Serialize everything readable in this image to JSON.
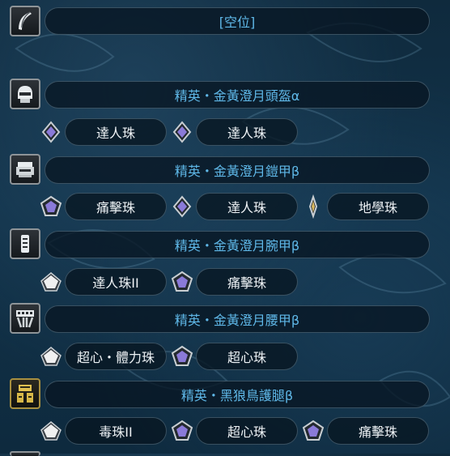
{
  "weapon": {
    "name": "[空位]",
    "icon": "weapon-icon"
  },
  "armor": [
    {
      "name": "精英・金黃澄月頭盔α",
      "icon": "helmet-icon",
      "decorations": [
        {
          "label": "達人珠",
          "slot_icon": "purple-deco-slot-icon"
        },
        {
          "label": "達人珠",
          "slot_icon": "purple-deco-slot-icon"
        }
      ]
    },
    {
      "name": "精英・金黃澄月鎧甲β",
      "icon": "chest-armor-icon",
      "decorations": [
        {
          "label": "痛擊珠",
          "slot_icon": "purple-deco-slot-icon"
        },
        {
          "label": "達人珠",
          "slot_icon": "purple-deco-slot-icon"
        },
        {
          "label": "地學珠",
          "slot_icon": "gold-deco-slot-icon"
        }
      ]
    },
    {
      "name": "精英・金黃澄月腕甲β",
      "icon": "arm-armor-icon",
      "decorations": [
        {
          "label": "達人珠II",
          "slot_icon": "white-deco-slot-icon"
        },
        {
          "label": "痛擊珠",
          "slot_icon": "purple-deco-slot-icon"
        }
      ]
    },
    {
      "name": "精英・金黃澄月腰甲β",
      "icon": "waist-armor-icon",
      "decorations": [
        {
          "label": "超心・體力珠",
          "slot_icon": "white-deco-slot-icon"
        },
        {
          "label": "超心珠",
          "slot_icon": "purple-deco-slot-icon"
        }
      ]
    },
    {
      "name": "精英・黑狼鳥護腿β",
      "icon": "leg-armor-icon",
      "decorations": [
        {
          "label": "毒珠II",
          "slot_icon": "white-deco-slot-icon"
        },
        {
          "label": "超心珠",
          "slot_icon": "purple-deco-slot-icon"
        },
        {
          "label": "痛擊珠",
          "slot_icon": "purple-deco-slot-icon"
        }
      ]
    }
  ],
  "colors": {
    "name_text": "#5fb8e8",
    "deco_text": "#eef2f5",
    "purple_gem": "#8a7ad8",
    "gold_gem": "#d8b860",
    "white_gem": "#f0f0f0"
  }
}
